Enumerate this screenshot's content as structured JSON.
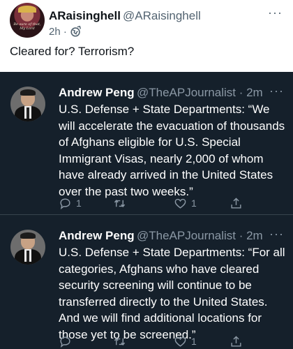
{
  "top_tweet": {
    "avatar_icon": "profile-photo-icon",
    "avatar_text": "Be sure of that, My Lord",
    "display_name": "ARaisinghell",
    "handle": "@ARaisinghell",
    "time": "2h ·",
    "visibility_icon": "globe-icon",
    "more_label": "···",
    "text": "Cleared for? Terrorism?"
  },
  "quoted_tweets": [
    {
      "display_name": "Andrew Peng",
      "handle_time": "@TheAPJournalist · 2m",
      "more_label": "···",
      "text": "U.S. Defense + State Departments: “We will accelerate the evacuation of thousands of Afghans eligible for U.S. Special Immigrant Visas, nearly 2,000 of whom have already arrived in the United States over the past two weeks.”",
      "reply_count": "1",
      "retweet_count": "",
      "like_count": "1"
    },
    {
      "display_name": "Andrew Peng",
      "handle_time": "@TheAPJournalist · 2m",
      "more_label": "···",
      "text": "U.S. Defense + State Departments: “For all categories, Afghans who have cleared security screening will continue to be transferred directly to the United States. And we will find additional locations for those yet to be screened.”",
      "reply_count": "",
      "retweet_count": "",
      "like_count": "1"
    }
  ],
  "colors": {
    "dark_background": "#15202b",
    "secondary_text": "#8b98a5",
    "divider": "#38444d"
  }
}
